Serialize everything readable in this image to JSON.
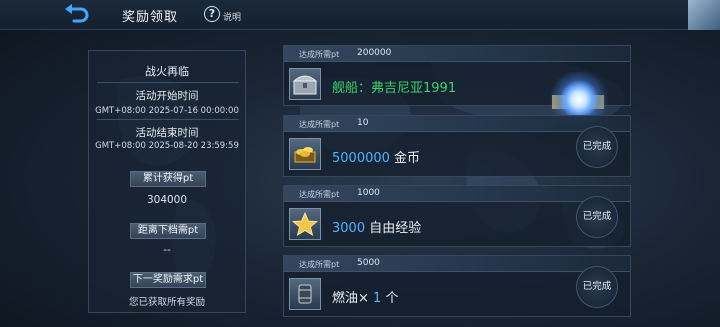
{
  "header": {
    "title": "奖励领取",
    "help_label": "说明"
  },
  "event": {
    "name": "战火再临",
    "start_label": "活动开始时间",
    "start_time": "GMT+08:00 2025-07-16 00:00:00",
    "end_label": "活动结束时间",
    "end_time": "GMT+08:00 2025-08-20 23:59:59",
    "accum_label": "累计获得pt",
    "accum_value": "304000",
    "next_tier_label": "距离下档需pt",
    "next_tier_value": "--",
    "next_reward_label": "下一奖励需求pt",
    "all_claimed_text": "您已获取所有奖励"
  },
  "rewards": [
    {
      "req_label": "达成所需pt",
      "req_value": "200000",
      "prefix": "舰船：",
      "name": "弗吉尼亚1991",
      "icon": "treasure-chest-icon",
      "status": ""
    },
    {
      "req_label": "达成所需pt",
      "req_value": "10",
      "amount": "5000000",
      "name": "金币",
      "icon": "gold-coins-icon",
      "status": "已完成"
    },
    {
      "req_label": "达成所需pt",
      "req_value": "1000",
      "amount": "3000",
      "name": "自由经验",
      "icon": "star-icon",
      "status": "已完成"
    },
    {
      "req_label": "达成所需pt",
      "req_value": "5000",
      "prefix": "燃油×",
      "amount": "1",
      "name": "个",
      "icon": "fuel-barrel-icon",
      "status": "已完成"
    }
  ],
  "colors": {
    "highlight": "#4fb2ff",
    "ship_name": "#39d36a"
  }
}
